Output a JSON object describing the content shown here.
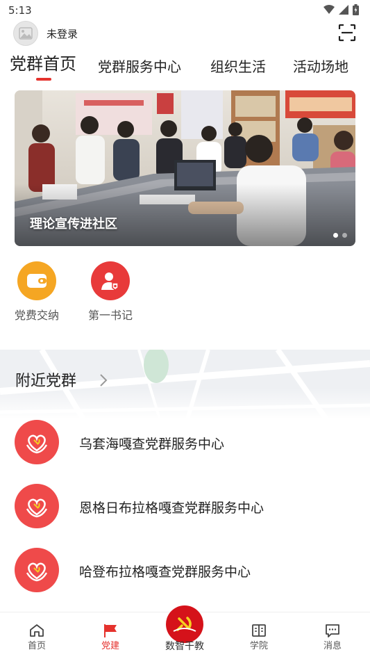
{
  "status": {
    "time": "5:13"
  },
  "user": {
    "login_label": "未登录"
  },
  "tabs": [
    {
      "label": "党群首页",
      "active": true
    },
    {
      "label": "党群服务中心"
    },
    {
      "label": "组织生活"
    },
    {
      "label": "活动场地"
    }
  ],
  "banner": {
    "caption": "理论宣传进社区",
    "slides": 2,
    "current": 1
  },
  "quick_actions": [
    {
      "label": "党费交纳",
      "icon": "wallet-icon",
      "color": "#f5a623"
    },
    {
      "label": "第一书记",
      "icon": "secretary-icon",
      "color": "#e83a3a"
    }
  ],
  "nearby": {
    "title": "附近党群",
    "items": [
      {
        "name": "乌套海嘎查党群服务中心"
      },
      {
        "name": "恩格日布拉格嘎查党群服务中心"
      },
      {
        "name": "哈登布拉格嘎查党群服务中心"
      }
    ]
  },
  "bottom_nav": [
    {
      "label": "首页",
      "icon": "home-icon"
    },
    {
      "label": "党建",
      "icon": "flag-icon",
      "active": true
    },
    {
      "label": "数智干教",
      "icon": "party-emblem-icon"
    },
    {
      "label": "学院",
      "icon": "book-icon"
    },
    {
      "label": "消息",
      "icon": "message-icon"
    }
  ],
  "colors": {
    "accent": "#e5322d",
    "quick_orange": "#f5a623",
    "quick_red": "#e83a3a",
    "center_icon": "#ef4a4a"
  }
}
